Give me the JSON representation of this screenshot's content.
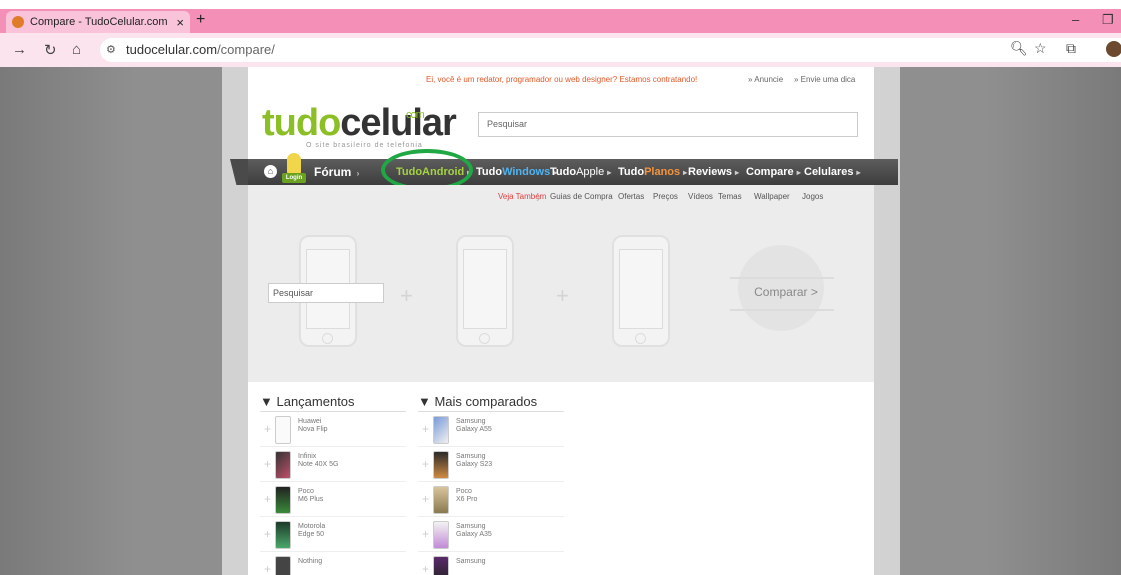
{
  "browser": {
    "tab_title": "Compare - TudoCelular.com",
    "tab_close": "×",
    "new_tab": "+",
    "url_host": "tudocelular.com",
    "url_path": "/compare/",
    "win_min": "–",
    "win_max": "❐"
  },
  "site": {
    "hiring_msg": "Ei, você é um redator, programador ou web designer? Estamos contratando!",
    "link_anuncie": "» Anuncie",
    "link_envie": "» Envie uma dica",
    "logo_a": "tudo",
    "logo_b": "celular",
    "logo_com": "com",
    "tagline": "O site brasileiro de telefonia",
    "search_placeholder": "Pesquisar",
    "login_label": "Login"
  },
  "nav": {
    "forum": "Fórum",
    "tudoandroid": "TudoAndroid",
    "tudowindows_a": "Tudo",
    "tudowindows_b": "Windows",
    "tudoapple_a": "Tudo",
    "tudoapple_b": "Apple",
    "tudoplanos_a": "Tudo",
    "tudoplanos_b": "Planos",
    "reviews": "Reviews",
    "compare": "Compare",
    "celulares": "Celulares"
  },
  "subnav": {
    "veja": "Veja Também",
    "items": [
      "Guias de Compra",
      "Ofertas",
      "Preços",
      "Vídeos",
      "Temas",
      "Wallpaper",
      "Jogos"
    ]
  },
  "compare": {
    "search_placeholder": "Pesquisar",
    "button": "Comparar >"
  },
  "lists": {
    "lancamentos_title": "▼ Lançamentos",
    "mais_title": "▼ Mais comparados",
    "lancamentos": [
      {
        "brand": "Huawei",
        "model": "Nova Flip"
      },
      {
        "brand": "Infinix",
        "model": "Note 40X 5G"
      },
      {
        "brand": "Poco",
        "model": "M6 Plus"
      },
      {
        "brand": "Motorola",
        "model": "Edge 50"
      },
      {
        "brand": "Nothing",
        "model": ""
      }
    ],
    "mais": [
      {
        "brand": "Samsung",
        "model": "Galaxy A55"
      },
      {
        "brand": "Samsung",
        "model": "Galaxy S23"
      },
      {
        "brand": "Poco",
        "model": "X6 Pro"
      },
      {
        "brand": "Samsung",
        "model": "Galaxy A35"
      },
      {
        "brand": "Samsung",
        "model": ""
      }
    ]
  },
  "colors": {
    "accent_green": "#8cbf26",
    "nav_dark": "#4a4a4a",
    "highlight_circle": "#1fa843",
    "tab_pink": "#f48fb8"
  }
}
